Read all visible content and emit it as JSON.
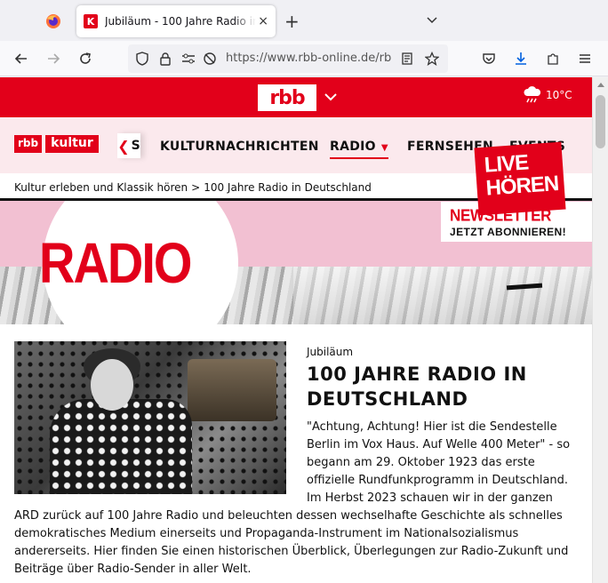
{
  "browser": {
    "tab_title": "Jubiläum - 100 Jahre Radio in Deutschland",
    "tab_favicon_letter": "K",
    "tab_close": "×",
    "new_tab": "+",
    "url": "https://www.rbb-online.de/rbbkultur",
    "icons": [
      "firefox-icon",
      "back-icon",
      "forward-icon",
      "reload-icon",
      "shield-icon",
      "lock-icon",
      "permissions-icon",
      "camera-off-icon",
      "reader-icon",
      "bookmark-star-icon",
      "pocket-icon",
      "download-icon",
      "extensions-icon",
      "menu-icon"
    ]
  },
  "rbb_header": {
    "logo": "rbb",
    "temperature": "10°C"
  },
  "section_nav": {
    "logo_part1": "rbb",
    "logo_part2": "kultur",
    "scroll_left_glyph": "❮",
    "scroll_left_peek": "S",
    "items": [
      {
        "label": "KULTURNACHRICHTEN",
        "active": false
      },
      {
        "label": "RADIO",
        "active": true,
        "indicator": "▼"
      },
      {
        "label": "FERNSEHEN",
        "active": false
      },
      {
        "label": "EVENTS",
        "active": false
      }
    ]
  },
  "breadcrumb": {
    "items": [
      "Kultur erleben und Klassik hören",
      "100 Jahre Radio in Deutschland"
    ],
    "separator": ">"
  },
  "hero": {
    "title": "RADIO",
    "newsletter_line1": "NEWSLETTER",
    "newsletter_line2": "JETZT ABONNIEREN!",
    "live_line1": "LIVE",
    "live_line2": "HÖREN"
  },
  "article": {
    "kicker": "Jubiläum",
    "headline": "100 JAHRE RADIO IN DEUTSCHLAND",
    "body_lines_float": [
      "\"Achtung, Achtung! Hier ist die Sendestelle",
      "Berlin im Vox Haus. Auf Welle 400 Meter\" - so",
      "begann am 29. Oktober 1923 das erste",
      "offizielle Rundfunkprogramm in Deutschland.",
      "Im Herbst 2023 schauen wir in der ganzen"
    ],
    "body_lines_full": [
      "ARD zurück auf 100 Jahre Radio und beleuchten dessen wechselhafte Geschichte als schnelles",
      "demokratisches Medium einerseits und Propaganda-Instrument im Nationalsozialismus",
      "andererseits. Hier finden Sie einen historischen Überblick, Überlegungen zur Radio-Zukunft und",
      "Beiträge über Radio-Sender in aller Welt."
    ]
  },
  "colors": {
    "rbb_red": "#e2001a",
    "nav_bg": "#fbe9ed",
    "hero_pink": "#f2c0d2"
  }
}
